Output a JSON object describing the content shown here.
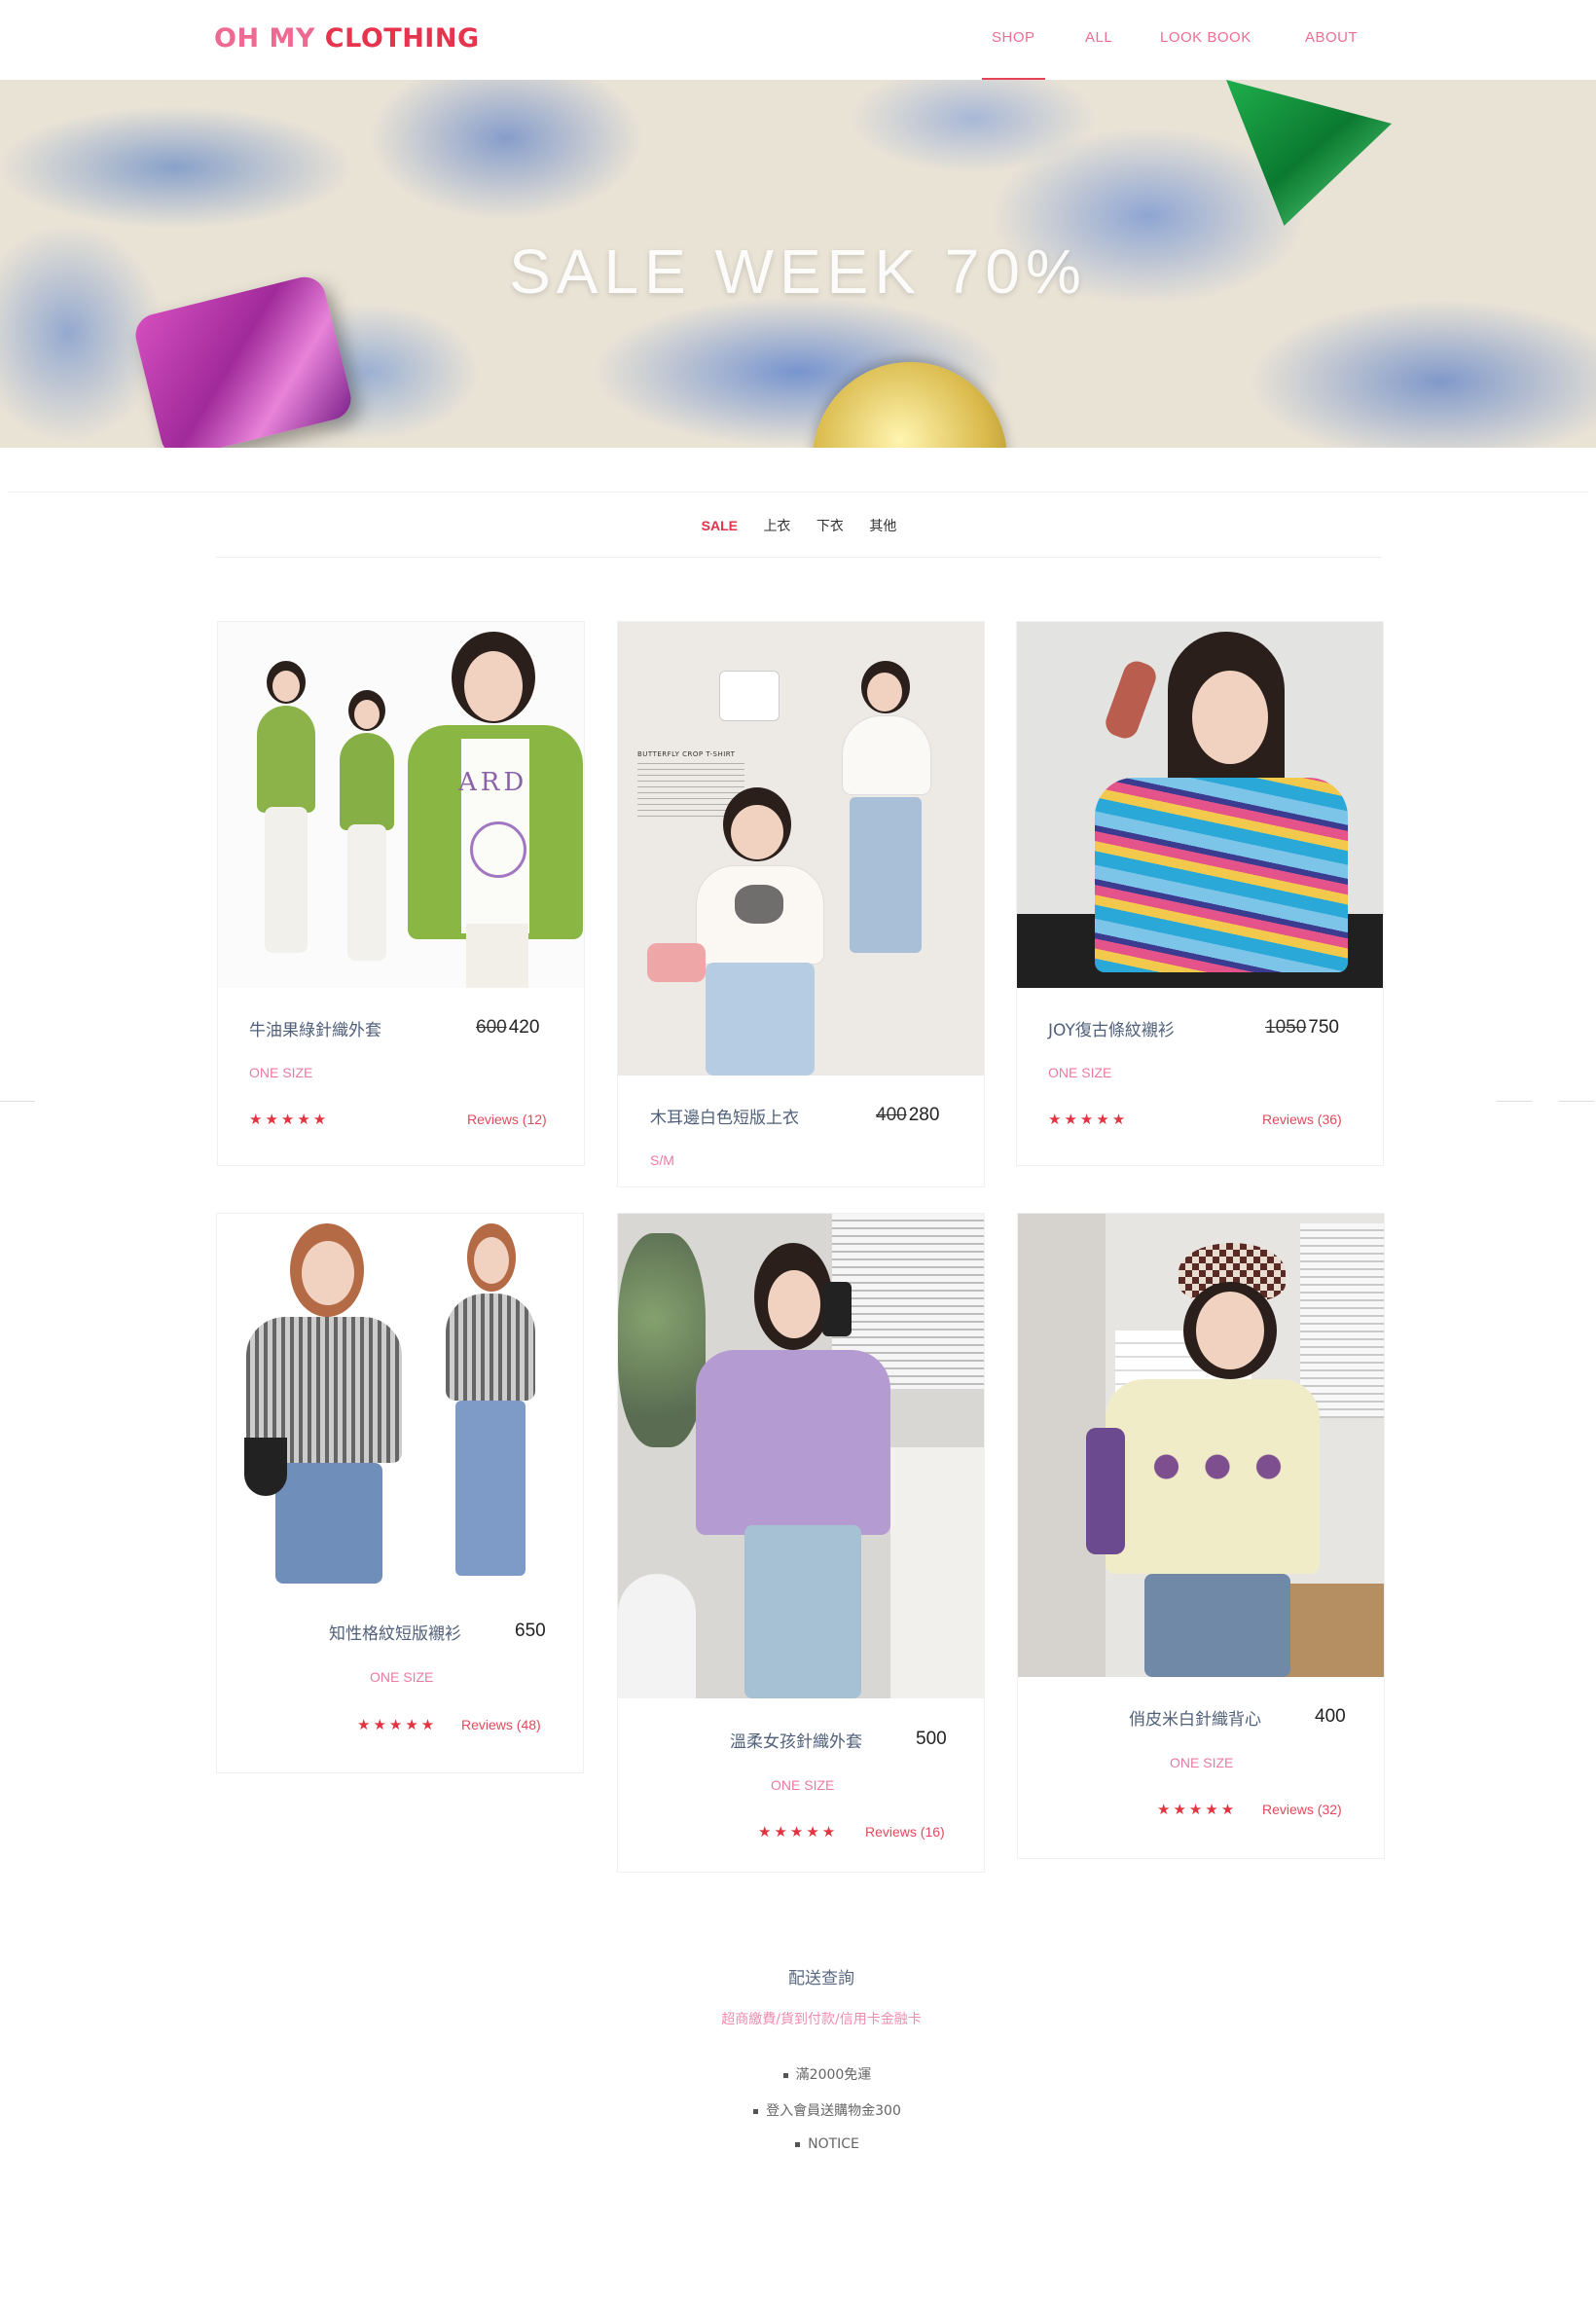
{
  "header": {
    "logo_part1": "OH MY ",
    "logo_part2": "CLOTHING",
    "nav": [
      {
        "label": "SHOP",
        "active": true
      },
      {
        "label": "ALL"
      },
      {
        "label": "LOOK BOOK"
      },
      {
        "label": "ABOUT"
      }
    ]
  },
  "banner": {
    "title": "SALE WEEK 70%"
  },
  "filters": [
    "SALE",
    "上衣",
    "下衣",
    "其他"
  ],
  "products": [
    {
      "name": "牛油果綠針織外套",
      "old_price": "600",
      "price": "420",
      "size": "ONE SIZE",
      "stars": "★★★★★",
      "reviews": "Reviews (12)"
    },
    {
      "name": "木耳邊白色短版上衣",
      "old_price": "400",
      "price": "280",
      "size": "S/M"
    },
    {
      "name": "JOY復古條紋襯衫",
      "old_price": "1050",
      "price": "750",
      "size": "ONE SIZE",
      "stars": "★★★★★",
      "reviews": "Reviews (36)"
    },
    {
      "name": "知性格紋短版襯衫",
      "price": "650",
      "size": "ONE SIZE",
      "stars": "★★★★★",
      "reviews": "Reviews (48)"
    },
    {
      "name": "溫柔女孩針織外套",
      "price": "500",
      "size": "ONE SIZE",
      "stars": "★★★★★",
      "reviews": "Reviews (16)"
    },
    {
      "name": "俏皮米白針織背心",
      "price": "400",
      "size": "ONE SIZE",
      "stars": "★★★★★",
      "reviews": "Reviews (32)"
    }
  ],
  "product2_label_text": "BUTTERFLY CROP T-SHIRT",
  "product1_print_text": "ARD",
  "footer": {
    "title": "配送查詢",
    "subtitle": "超商繳費/貨到付款/信用卡金融卡",
    "items": [
      "滿2000免運",
      "登入會員送購物金300",
      "NOTICE"
    ]
  },
  "colors": {
    "accent": "#e2314b",
    "pink": "#ef6a92",
    "text": "#50607a"
  }
}
